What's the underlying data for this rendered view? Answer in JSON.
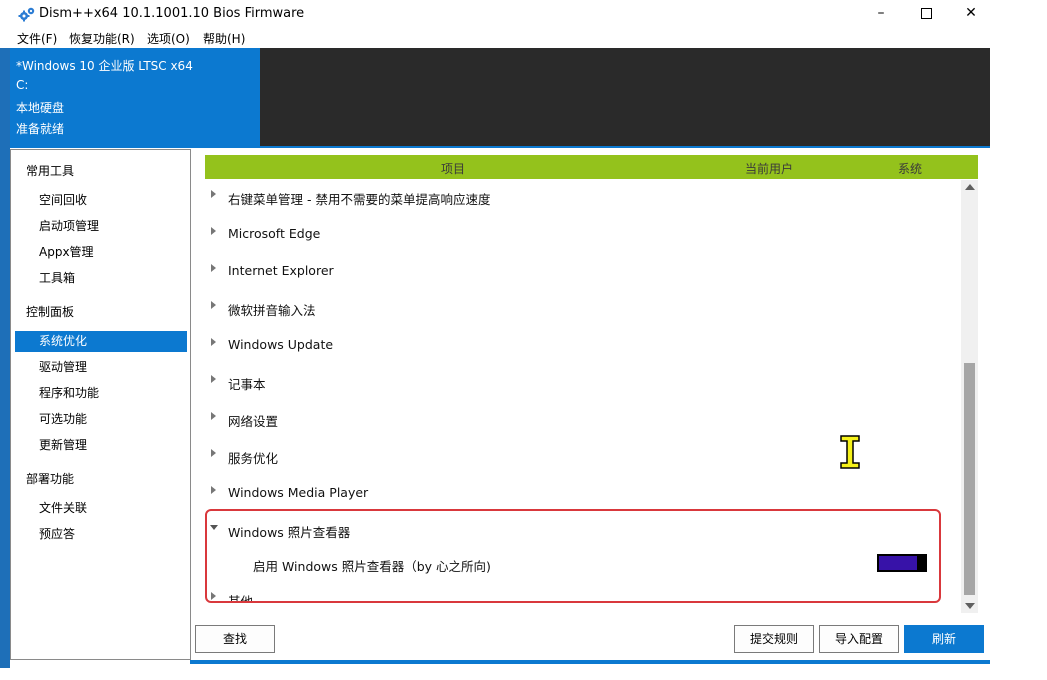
{
  "window": {
    "title": "Dism++x64 10.1.1001.10 Bios Firmware",
    "controls": {
      "minimize": "–",
      "close": "✕"
    }
  },
  "menu": [
    "文件(F)",
    "恢复功能(R)",
    "选项(O)",
    "帮助(H)"
  ],
  "header": {
    "os": "*Windows 10 企业版 LTSC x64",
    "drive": "C:",
    "disk_type": "本地硬盘",
    "status": "准备就绪"
  },
  "sidebar": {
    "groups": [
      {
        "title": "常用工具",
        "items": [
          "空间回收",
          "启动项管理",
          "Appx管理",
          "工具箱"
        ]
      },
      {
        "title": "控制面板",
        "items": [
          "系统优化",
          "驱动管理",
          "程序和功能",
          "可选功能",
          "更新管理"
        ]
      },
      {
        "title": "部署功能",
        "items": [
          "文件关联",
          "预应答"
        ]
      }
    ],
    "active_item": "系统优化"
  },
  "table": {
    "columns": [
      "项目",
      "当前用户",
      "系统"
    ],
    "rows": [
      "右键菜单管理 - 禁用不需要的菜单提高响应速度",
      "Microsoft Edge",
      "Internet Explorer",
      "微软拼音输入法",
      "Windows Update",
      "记事本",
      "网络设置",
      "服务优化",
      "Windows Media Player",
      "Windows 照片查看器",
      "其他"
    ],
    "expanded_row": "Windows 照片查看器",
    "sub_item": {
      "label": "启用 Windows 照片查看器（by 心之所向)",
      "toggle_on": true
    },
    "colors": {
      "header": "#94c21c",
      "toggle": "#3712a8",
      "highlight": "#d9383c"
    }
  },
  "buttons": {
    "find": "查找",
    "submit_rules": "提交规则",
    "import_config": "导入配置",
    "refresh": "刷新"
  },
  "icons": {
    "app": "gears-icon",
    "cursor": "text-cursor-icon"
  }
}
